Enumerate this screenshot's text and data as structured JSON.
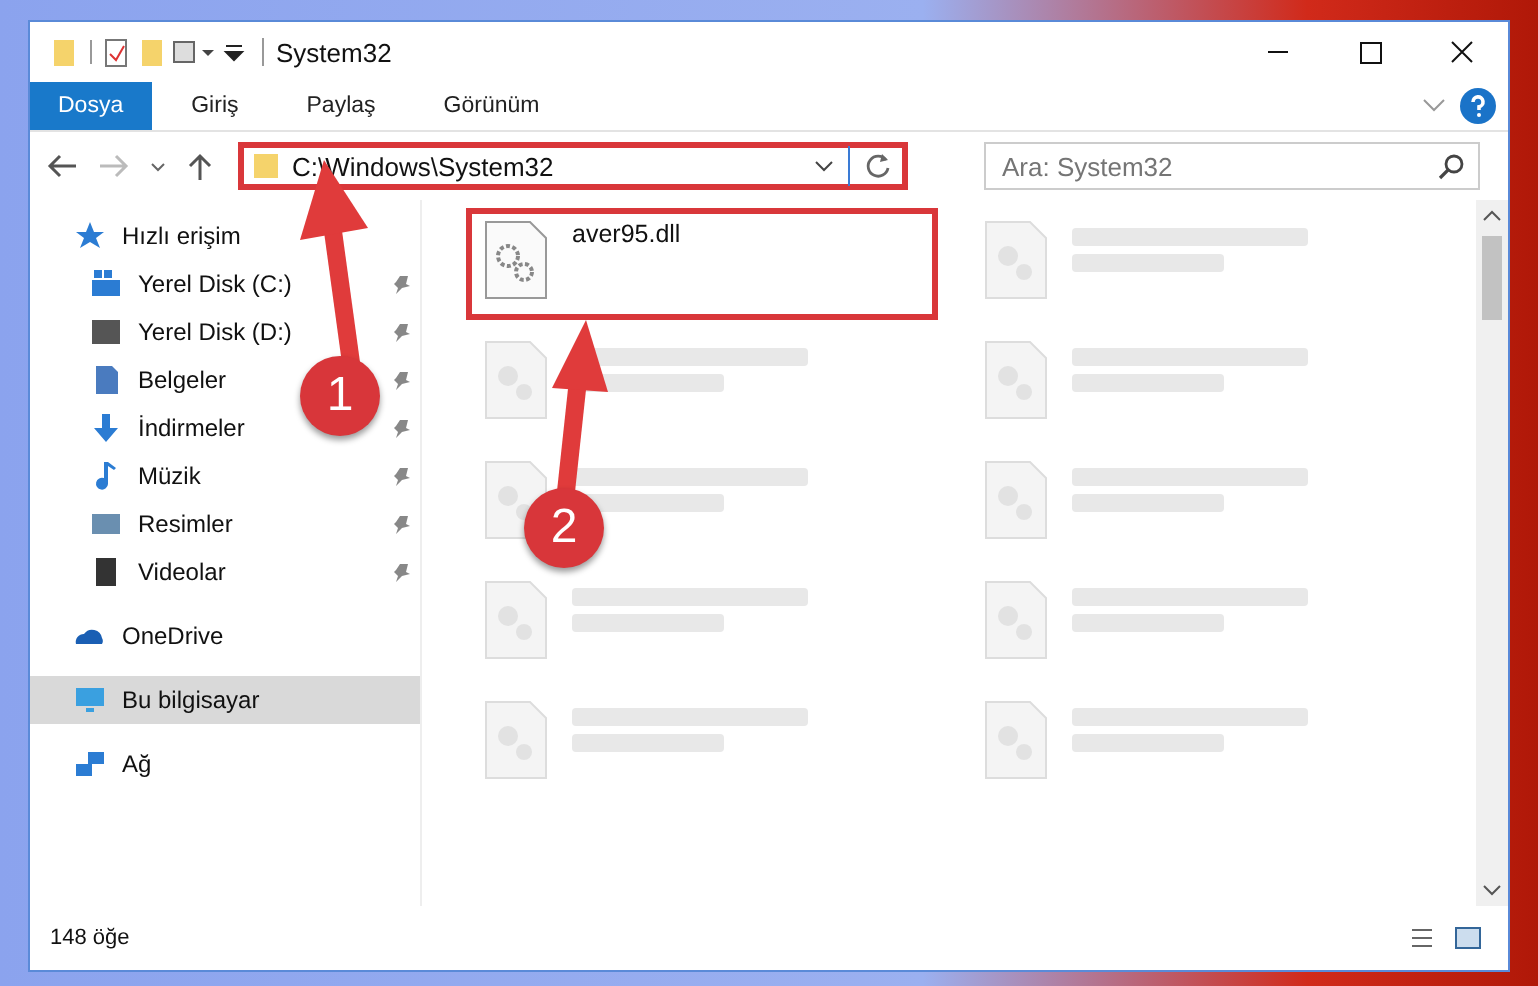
{
  "window": {
    "title": "System32"
  },
  "ribbon_tabs": [
    {
      "label": "Dosya",
      "selected": true
    },
    {
      "label": "Giriş",
      "selected": false
    },
    {
      "label": "Paylaş",
      "selected": false
    },
    {
      "label": "Görünüm",
      "selected": false
    }
  ],
  "address_bar": {
    "path": "C:\\Windows\\System32",
    "highlighted": true
  },
  "search": {
    "placeholder": "Ara: System32"
  },
  "sidebar": {
    "items": [
      {
        "label": "Hızlı erişim",
        "kind": "star",
        "pinned": false,
        "selected": false
      },
      {
        "label": "Yerel Disk (C:)",
        "kind": "drive-c",
        "pinned": true,
        "selected": false
      },
      {
        "label": "Yerel Disk (D:)",
        "kind": "drive",
        "pinned": true,
        "selected": false
      },
      {
        "label": "Belgeler",
        "kind": "document",
        "pinned": true,
        "selected": false
      },
      {
        "label": "İndirmeler",
        "kind": "download",
        "pinned": true,
        "selected": false
      },
      {
        "label": "Müzik",
        "kind": "music",
        "pinned": true,
        "selected": false
      },
      {
        "label": "Resimler",
        "kind": "picture",
        "pinned": true,
        "selected": false
      },
      {
        "label": "Videolar",
        "kind": "video",
        "pinned": true,
        "selected": false
      },
      {
        "label": "OneDrive",
        "kind": "cloud",
        "pinned": false,
        "selected": false
      },
      {
        "label": "Bu bilgisayar",
        "kind": "computer",
        "pinned": false,
        "selected": true
      },
      {
        "label": "Ağ",
        "kind": "network",
        "pinned": false,
        "selected": false
      }
    ]
  },
  "files": [
    {
      "name": "aver95.dll",
      "highlighted": true,
      "blurred": false
    },
    {
      "highlighted": false,
      "blurred": true
    },
    {
      "highlighted": false,
      "blurred": true
    },
    {
      "highlighted": false,
      "blurred": true
    },
    {
      "highlighted": false,
      "blurred": true
    },
    {
      "highlighted": false,
      "blurred": true
    },
    {
      "highlighted": false,
      "blurred": true
    },
    {
      "highlighted": false,
      "blurred": true
    },
    {
      "highlighted": false,
      "blurred": true
    },
    {
      "highlighted": false,
      "blurred": true
    }
  ],
  "status_bar": {
    "item_count": "148 öğe"
  },
  "annotations": [
    {
      "label": "1"
    },
    {
      "label": "2"
    }
  ]
}
